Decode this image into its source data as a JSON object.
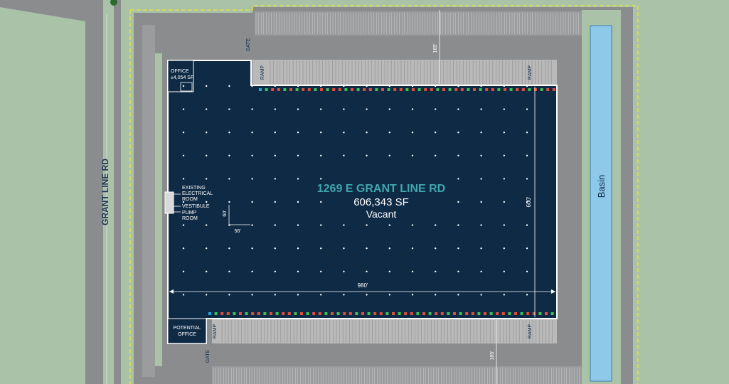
{
  "site": {
    "street_name": "GRANT LINE RD",
    "basin_label": "Basin",
    "gate_label": "GATE",
    "ramp_label": "RAMP"
  },
  "building": {
    "address": "1269 E GRANT LINE RD",
    "area": "606,343 SF",
    "status": "Vacant",
    "width_dim": "980'",
    "depth_dim": "600'",
    "bay_width": "56'",
    "bay_depth": "60'",
    "truck_court_top": "185'",
    "truck_court_bottom": "185'"
  },
  "rooms": {
    "office_title": "OFFICE",
    "office_area": "±4,054 SF",
    "electrical_line1": "EXISTING",
    "electrical_line2": "ELECTRICAL",
    "electrical_line3": "ROOM",
    "vestibule": "VESTIBULE",
    "pump_line1": "PUMP",
    "pump_line2": "ROOM",
    "potential_line1": "POTENTIAL",
    "potential_line2": "OFFICE"
  },
  "colors": {
    "grass": "#a9c2a8",
    "pavement": "#8a8c8e",
    "building": "#0e2a44",
    "dock_doors": "#b9b9b9",
    "basin": "#8ec9ea",
    "title_teal": "#3fa6b0",
    "property_line": "#e4e04a",
    "door_red": "#e04c3c",
    "door_green": "#3fbf56",
    "door_blue": "#1fa4e0"
  }
}
